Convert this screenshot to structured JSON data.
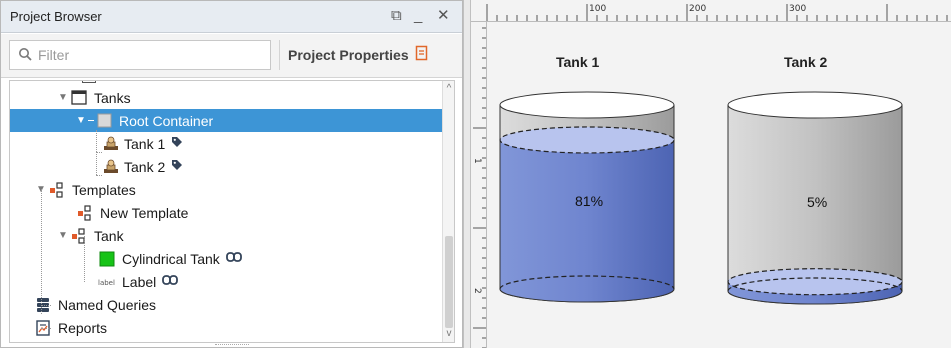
{
  "browser": {
    "title": "Project Browser",
    "controls": {
      "restore": "⧉",
      "minimize": "_",
      "close": "✕"
    },
    "filter": {
      "placeholder": "Filter",
      "value": ""
    },
    "project_properties": "Project Properties",
    "tree": [
      {
        "label": "Tanks",
        "icon": "window-icon",
        "expanded": true
      },
      {
        "label": "Root Container",
        "icon": "container-icon",
        "expanded": true,
        "selected": true
      },
      {
        "label": "Tank 1",
        "icon": "template-instance-icon",
        "tag": "tag-icon"
      },
      {
        "label": "Tank 2",
        "icon": "template-instance-icon",
        "tag": "tag-icon"
      },
      {
        "label": "Templates",
        "icon": "templates-icon",
        "expanded": true
      },
      {
        "label": "New Template",
        "icon": "templates-icon"
      },
      {
        "label": "Tank",
        "icon": "templates-icon",
        "expanded": true
      },
      {
        "label": "Cylindrical Tank",
        "icon": "green-square-icon",
        "link": "link-icon"
      },
      {
        "label": "Label",
        "icon": "label-icon",
        "link": "link-icon",
        "icon_text": "label"
      },
      {
        "label": "Named Queries",
        "icon": "named-queries-icon"
      },
      {
        "label": "Reports",
        "icon": "reports-icon"
      }
    ]
  },
  "designer": {
    "ruler": {
      "h_labels": [
        "100",
        "200",
        "300"
      ],
      "v_labels": [
        "1",
        "2"
      ]
    },
    "tanks": [
      {
        "title": "Tank 1",
        "level": 0.81,
        "percent_text": "81%"
      },
      {
        "title": "Tank 2",
        "level": 0.05,
        "percent_text": "5%"
      }
    ],
    "colors": {
      "liquid": "#6f85cf",
      "liquid_dark": "#4d64b3",
      "body": "#c7c7c7",
      "selected": "#3d95d6"
    }
  }
}
